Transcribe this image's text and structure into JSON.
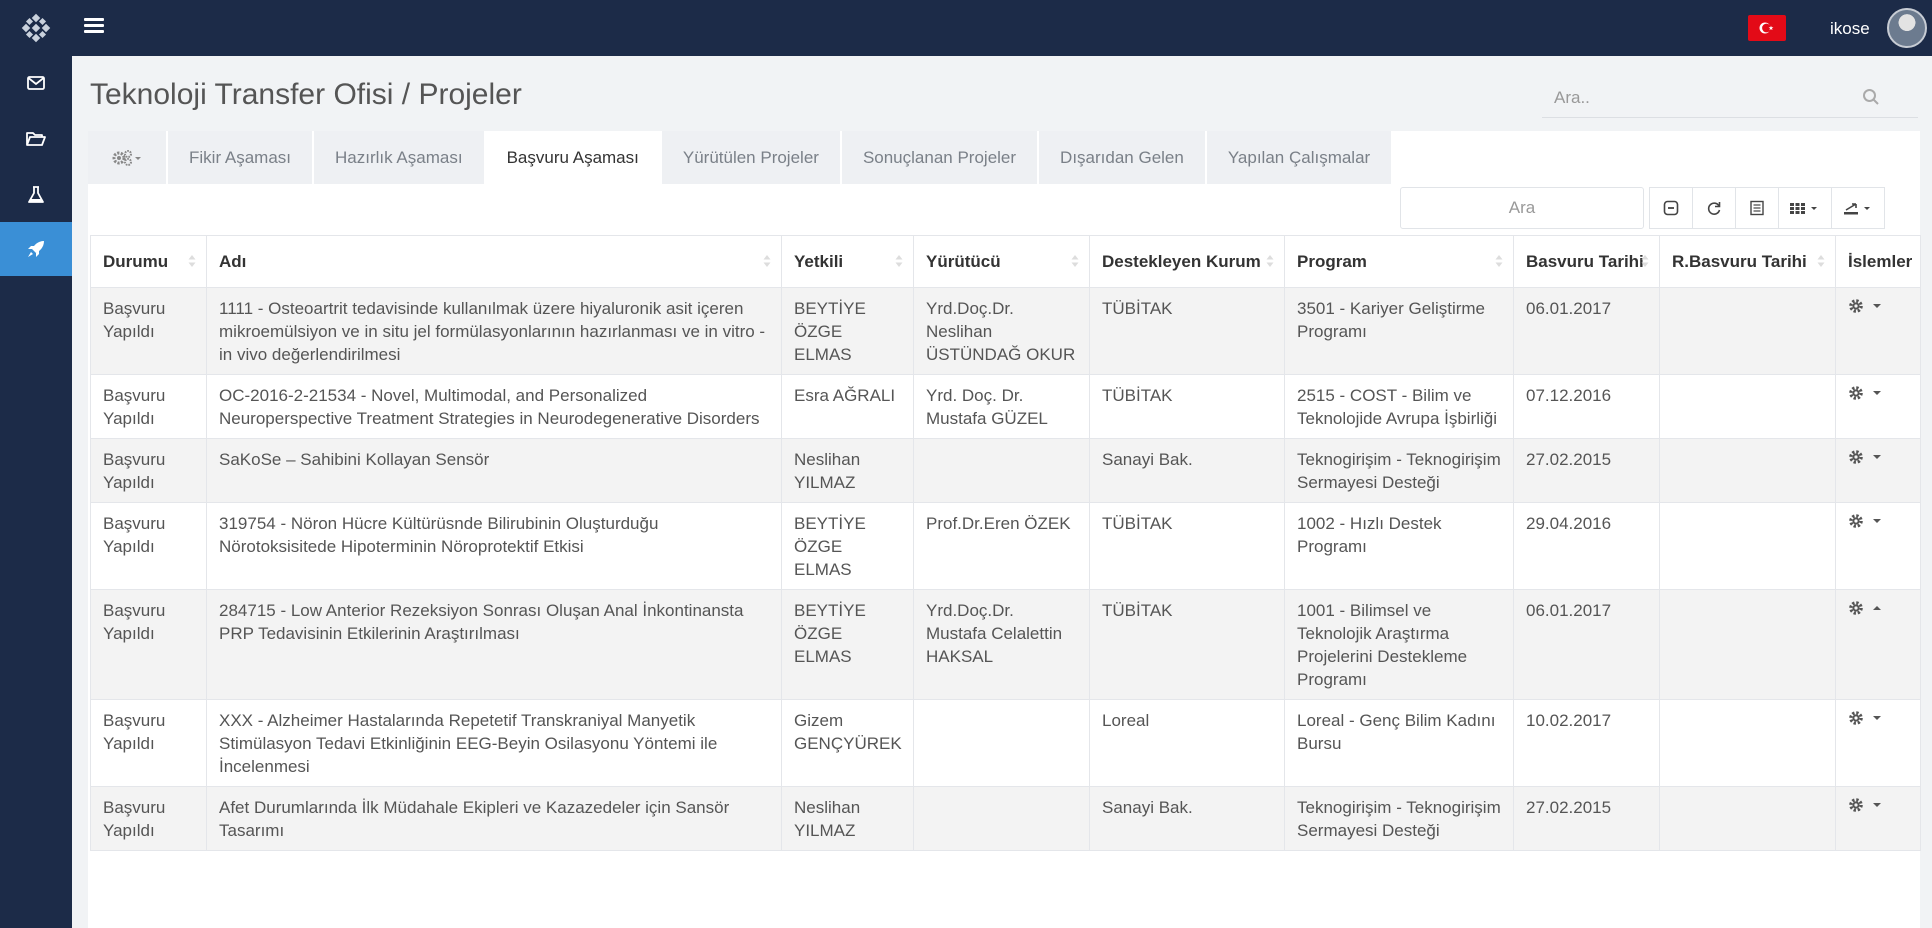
{
  "header": {
    "username": "ikose"
  },
  "sidebar": {
    "items": [
      {
        "icon": "envelope-icon"
      },
      {
        "icon": "folder-open-icon"
      },
      {
        "icon": "flask-icon"
      },
      {
        "icon": "rocket-icon",
        "active": true
      }
    ]
  },
  "page": {
    "title": "Teknoloji Transfer Ofisi / Projeler",
    "search_placeholder": "Ara.."
  },
  "tabs": [
    {
      "label": "Fikir Aşaması"
    },
    {
      "label": "Hazırlık Aşaması"
    },
    {
      "label": "Başvuru Aşaması",
      "active": true
    },
    {
      "label": "Yürütülen Projeler"
    },
    {
      "label": "Sonuçlanan Projeler"
    },
    {
      "label": "Dışarıdan Gelen"
    },
    {
      "label": "Yapılan Çalışmalar"
    }
  ],
  "table": {
    "search_placeholder": "Ara",
    "columns": [
      "Durumu",
      "Adı",
      "Yetkili",
      "Yürütücü",
      "Destekleyen Kurum",
      "Program",
      "Basvuru Tarihi",
      "R.Basvuru Tarihi",
      "İslemler"
    ],
    "rows": [
      {
        "durum": "Başvuru Yapıldı",
        "adi": "1111 - Osteoartrit tedavisinde kullanılmak üzere hiyaluronik asit içeren mikroemülsiyon ve in situ jel formülasyonlarının hazırlanması ve in vitro - in vivo değerlendirilmesi",
        "yetkili": "BEYTİYE ÖZGE ELMAS",
        "yurutucu": "Yrd.Doç.Dr. Neslihan ÜSTÜNDAĞ OKUR",
        "kurum": "TÜBİTAK",
        "program": "3501 - Kariyer Geliştirme Programı",
        "tarih": "06.01.2017",
        "rtarih": "",
        "caret": "down"
      },
      {
        "durum": "Başvuru Yapıldı",
        "adi": "OC-2016-2-21534 - Novel, Multimodal, and Personalized Neuroperspective Treatment Strategies in Neurodegenerative Disorders",
        "yetkili": "Esra AĞRALI",
        "yurutucu": "Yrd. Doç. Dr. Mustafa GÜZEL",
        "kurum": "TÜBİTAK",
        "program": "2515 - COST - Bilim ve Teknolojide Avrupa İşbirliği",
        "tarih": "07.12.2016",
        "rtarih": "",
        "caret": "down"
      },
      {
        "durum": "Başvuru Yapıldı",
        "adi": "SaKoSe – Sahibini Kollayan Sensör",
        "yetkili": "Neslihan YILMAZ",
        "yurutucu": "",
        "kurum": "Sanayi Bak.",
        "program": "Teknogirişim - Teknogirişim Sermayesi Desteği",
        "tarih": "27.02.2015",
        "rtarih": "",
        "caret": "down"
      },
      {
        "durum": "Başvuru Yapıldı",
        "adi": "319754 - Nöron Hücre Kültürüsnde Bilirubinin Oluşturduğu Nörotoksisitede Hipoterminin Nöroprotektif Etkisi",
        "yetkili": "BEYTİYE ÖZGE ELMAS",
        "yurutucu": "Prof.Dr.Eren ÖZEK",
        "kurum": "TÜBİTAK",
        "program": "1002 - Hızlı Destek Programı",
        "tarih": "29.04.2016",
        "rtarih": "",
        "caret": "down"
      },
      {
        "durum": "Başvuru Yapıldı",
        "adi": "284715 - Low Anterior Rezeksiyon Sonrası Oluşan Anal İnkontinansta PRP Tedavisinin Etkilerinin Araştırılması",
        "yetkili": "BEYTİYE ÖZGE ELMAS",
        "yurutucu": "Yrd.Doç.Dr. Mustafa Celalettin HAKSAL",
        "kurum": "TÜBİTAK",
        "program": "1001 - Bilimsel ve Teknolojik Araştırma Projelerini Destekleme Programı",
        "tarih": "06.01.2017",
        "rtarih": "",
        "caret": "up"
      },
      {
        "durum": "Başvuru Yapıldı",
        "adi": "XXX - Alzheimer Hastalarında Repetetif Transkraniyal Manyetik Stimülasyon Tedavi Etkinliğinin EEG-Beyin Osilasyonu Yöntemi ile İncelenmesi",
        "yetkili": "Gizem GENÇYÜREK",
        "yurutucu": "",
        "kurum": "Loreal",
        "program": "Loreal - Genç Bilim Kadını Bursu",
        "tarih": "10.02.2017",
        "rtarih": "",
        "caret": "down"
      },
      {
        "durum": "Başvuru Yapıldı",
        "adi": "Afet Durumlarında İlk Müdahale Ekipleri ve Kazazedeler için Sansör Tasarımı",
        "yetkili": "Neslihan YILMAZ",
        "yurutucu": "",
        "kurum": "Sanayi Bak.",
        "program": "Teknogirişim - Teknogirişim Sermayesi Desteği",
        "tarih": "27.02.2015",
        "rtarih": "",
        "caret": "down"
      }
    ]
  },
  "colors": {
    "navbar": "#1c2b48",
    "active_sidebar": "#3a8fd6",
    "flag": "#e30a17"
  }
}
